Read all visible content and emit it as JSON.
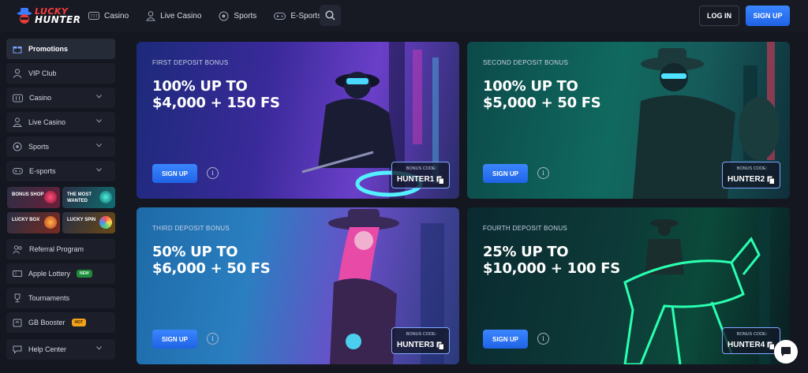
{
  "brand": {
    "line1": "LUCKY",
    "line2": "HUNTER"
  },
  "nav": {
    "casino": "Casino",
    "live_casino": "Live Casino",
    "sports": "Sports",
    "esports": "E-Sports"
  },
  "auth": {
    "login": "LOG IN",
    "signup": "SIGN UP"
  },
  "sidebar": {
    "items": [
      {
        "label": "Promotions"
      },
      {
        "label": "VIP Club"
      },
      {
        "label": "Casino"
      },
      {
        "label": "Live Casino"
      },
      {
        "label": "Sports"
      },
      {
        "label": "E-sports"
      },
      {
        "label": "Referral Program"
      },
      {
        "label": "Apple Lottery",
        "badge": "NEW"
      },
      {
        "label": "Tournaments"
      },
      {
        "label": "GB Booster",
        "badge": "HOT"
      },
      {
        "label": "Help Center"
      }
    ],
    "tiles": [
      {
        "label": "BONUS SHOP"
      },
      {
        "label": "THE MOST WANTED"
      },
      {
        "label": "LUCKY BOX"
      },
      {
        "label": "LUCKY SPIN"
      }
    ]
  },
  "promos": [
    {
      "eyebrow": "FIRST DEPOSIT BONUS",
      "line1": "100% UP TO",
      "line2": "$4,000 + 150 FS",
      "button": "SIGN UP",
      "code_label": "BONUS CODE:",
      "code": "HUNTER1"
    },
    {
      "eyebrow": "SECOND DEPOSIT BONUS",
      "line1": "100% UP TO",
      "line2": "$5,000 + 50 FS",
      "button": "SIGN UP",
      "code_label": "BONUS CODE:",
      "code": "HUNTER2"
    },
    {
      "eyebrow": "THIRD DEPOSIT BONUS",
      "line1": "50% UP TO",
      "line2": "$6,000 + 50 FS",
      "button": "SIGN UP",
      "code_label": "BONUS CODE:",
      "code": "HUNTER3"
    },
    {
      "eyebrow": "FOURTH DEPOSIT BONUS",
      "line1": "25% UP TO",
      "line2": "$10,000 + 100 FS",
      "button": "SIGN UP",
      "code_label": "BONUS CODE:",
      "code": "HUNTER4"
    }
  ],
  "info_glyph": "i",
  "colors": {
    "accent": "#2a72f4",
    "hot": "#f2a21b",
    "new": "#1f8a3b",
    "brand_red": "#ff3b3b"
  }
}
